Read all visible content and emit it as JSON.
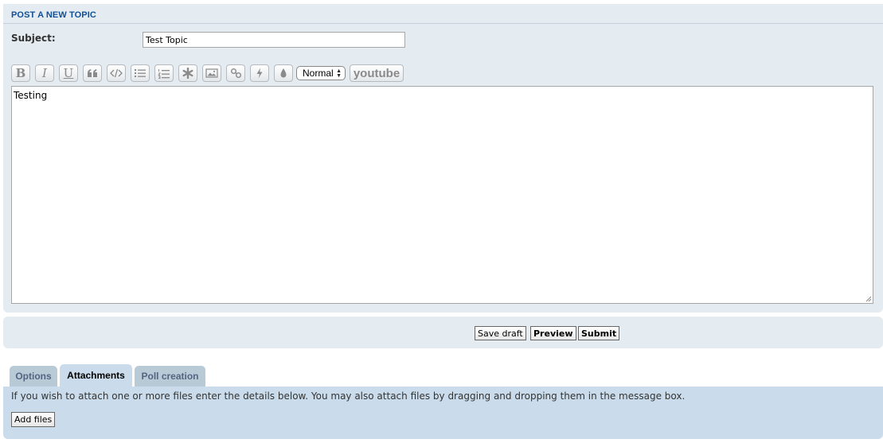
{
  "panel": {
    "title": "POST A NEW TOPIC"
  },
  "subject": {
    "label": "Subject:",
    "value": "Test Topic"
  },
  "toolbar": {
    "bold_label": "B",
    "italic_label": "I",
    "underline_label": "U",
    "buttons": [
      {
        "icon": "bold-icon"
      },
      {
        "icon": "italic-icon"
      },
      {
        "icon": "underline-icon"
      },
      {
        "icon": "quote-icon"
      },
      {
        "icon": "code-icon"
      },
      {
        "icon": "bulleted-list-icon"
      },
      {
        "icon": "numbered-list-icon"
      },
      {
        "icon": "list-item-asterisk-icon"
      },
      {
        "icon": "image-icon"
      },
      {
        "icon": "link-icon"
      },
      {
        "icon": "flash-icon"
      },
      {
        "icon": "font-color-icon"
      }
    ],
    "font_size": "Normal",
    "youtube_label": "youtube"
  },
  "editor": {
    "content": "Testing"
  },
  "actions": {
    "save_draft": "Save draft",
    "preview": "Preview",
    "submit": "Submit"
  },
  "tabs": [
    {
      "label": "Options",
      "active": false
    },
    {
      "label": "Attachments",
      "active": true
    },
    {
      "label": "Poll creation",
      "active": false
    }
  ],
  "attachments": {
    "help_text": "If you wish to attach one or more files enter the details below. You may also attach files by dragging and dropping them in the message box.",
    "add_files_label": "Add files"
  },
  "colors": {
    "panel_bg": "#e4ebf1",
    "title_blue": "#115098",
    "tab_active_bg": "#cadceb",
    "tab_inactive_bg": "#b9cad7"
  }
}
